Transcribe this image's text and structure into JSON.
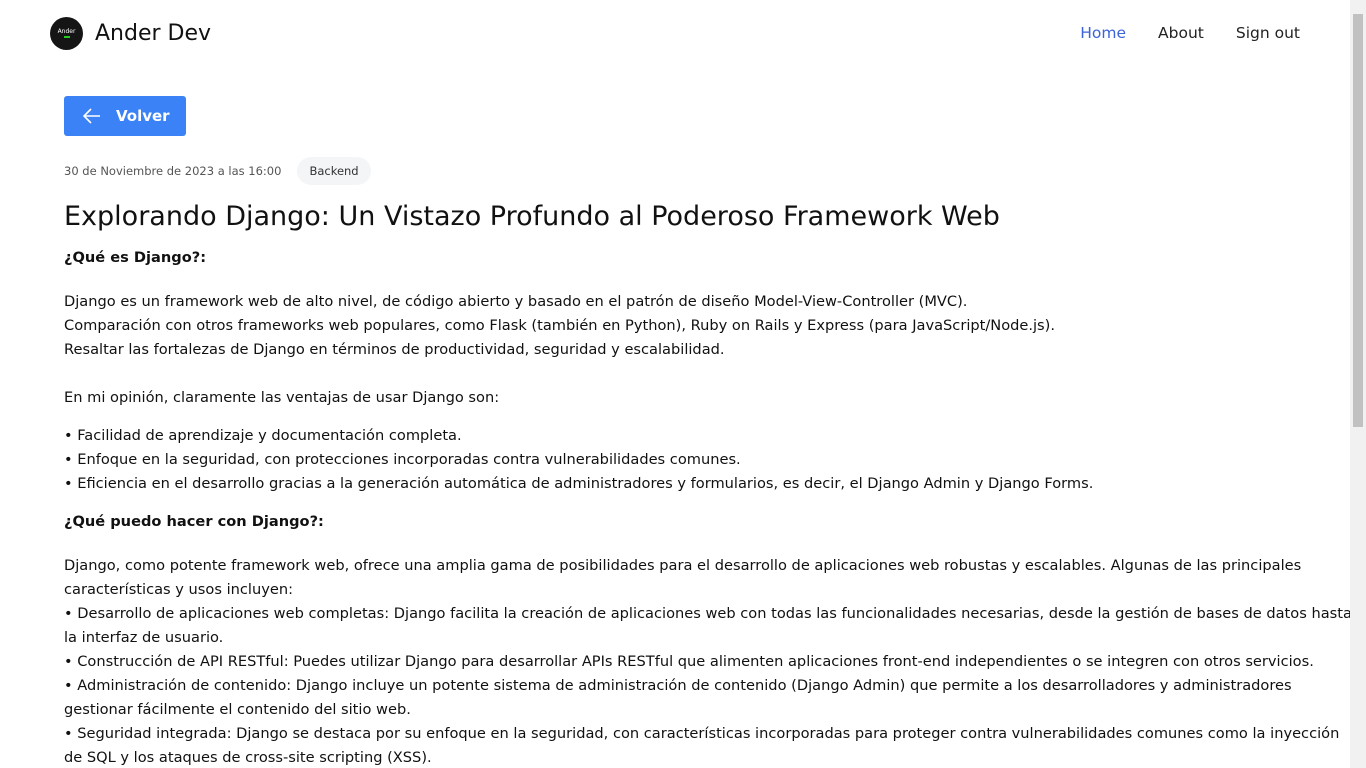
{
  "nav": {
    "brand": "Ander Dev",
    "logo_text": "Ander",
    "links": [
      "Home",
      "About",
      "Sign out"
    ]
  },
  "back_label": "Volver",
  "post": {
    "date": "30 de Noviembre de 2023 a las 16:00",
    "tag": "Backend",
    "title": "Explorando Django: Un Vistazo Profundo al Poderoso Framework Web",
    "h1": "¿Qué es Django?:",
    "p1": [
      "Django es un framework web de alto nivel, de código abierto y basado en el patrón de diseño Model-View-Controller (MVC).",
      "Comparación con otros frameworks web populares, como Flask (también en Python), Ruby on Rails y Express (para JavaScript/Node.js).",
      "Resaltar las fortalezas de Django en términos de productividad, seguridad y escalabilidad."
    ],
    "p2": "En mi opinión, claramente las ventajas de usar Django son:",
    "list1": [
      "• Facilidad de aprendizaje y documentación completa.",
      "• Enfoque en la seguridad, con protecciones incorporadas contra vulnerabilidades comunes.",
      "• Eficiencia en el desarrollo gracias a la generación automática de administradores y formularios, es decir, el Django Admin y Django Forms."
    ],
    "h2": "¿Qué puedo hacer con Django?:",
    "p3": "Django, como potente framework web, ofrece una amplia gama de posibilidades para el desarrollo de aplicaciones web robustas y escalables. Algunas de las principales características y usos incluyen:",
    "list2": [
      "• Desarrollo de aplicaciones web completas: Django facilita la creación de aplicaciones web con todas las funcionalidades necesarias, desde la gestión de bases de datos hasta la interfaz de usuario.",
      "• Construcción de API RESTful: Puedes utilizar Django para desarrollar APIs RESTful que alimenten aplicaciones front-end independientes o se integren con otros servicios.",
      "• Administración de contenido: Django incluye un potente sistema de administración de contenido (Django Admin) que permite a los desarrolladores y administradores gestionar fácilmente el contenido del sitio web.",
      "• Seguridad integrada: Django se destaca por su enfoque en la seguridad, con características incorporadas para proteger contra vulnerabilidades comunes como la inyección de SQL y los ataques de cross-site scripting (XSS)."
    ]
  }
}
